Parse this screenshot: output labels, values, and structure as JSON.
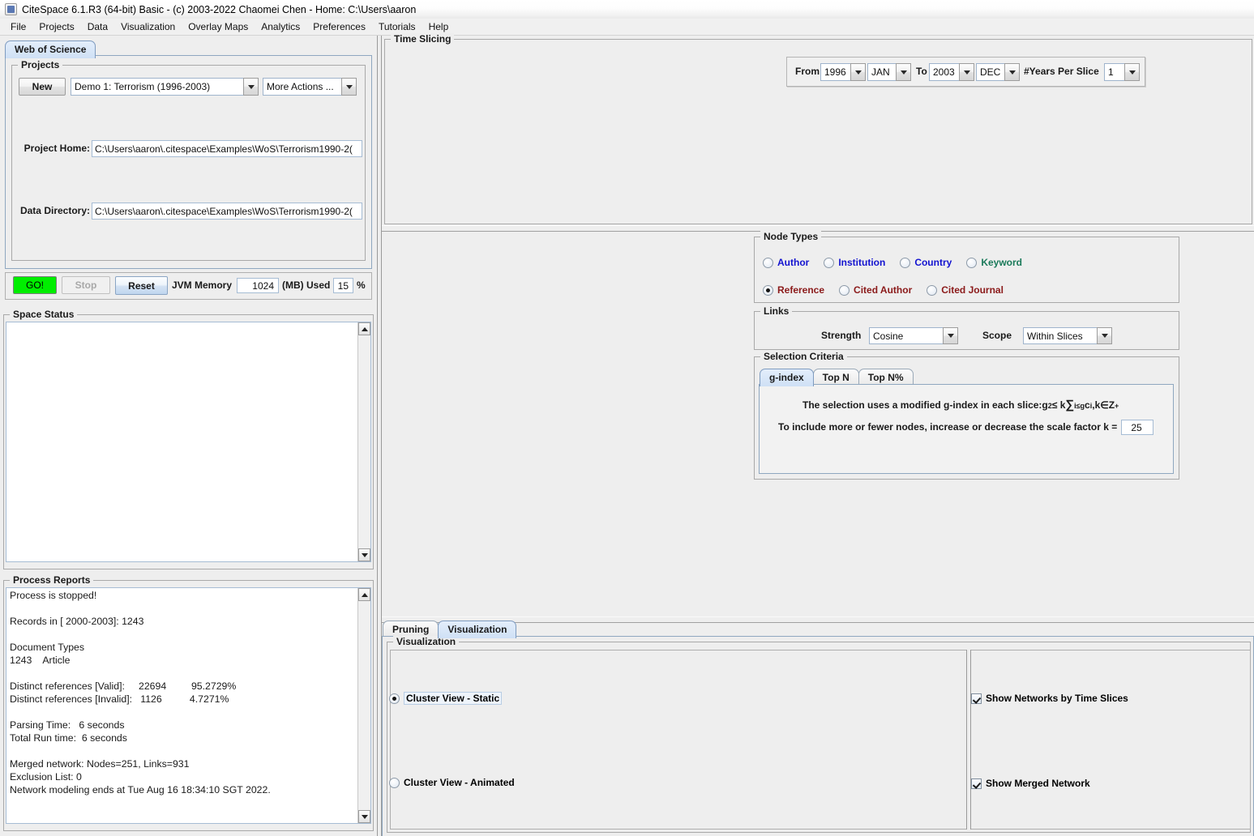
{
  "window": {
    "title": "CiteSpace 6.1.R3 (64-bit) Basic - (c) 2003-2022 Chaomei Chen - Home: C:\\Users\\aaron",
    "icon": "citespace-app-icon"
  },
  "menubar": {
    "items": [
      {
        "label": "File"
      },
      {
        "label": "Projects"
      },
      {
        "label": "Data"
      },
      {
        "label": "Visualization"
      },
      {
        "label": "Overlay Maps"
      },
      {
        "label": "Analytics"
      },
      {
        "label": "Preferences"
      },
      {
        "label": "Tutorials"
      },
      {
        "label": "Help"
      }
    ]
  },
  "left": {
    "tab": {
      "label": "Web of Science"
    },
    "projects": {
      "title": "Projects",
      "new_button": "New",
      "project_combo": "Demo 1: Terrorism (1996-2003)",
      "more_actions_combo": "More Actions ...",
      "project_home_label": "Project Home:",
      "project_home_value": "C:\\Users\\aaron\\.citespace\\Examples\\WoS\\Terrorism1990-2(",
      "data_directory_label": "Data Directory:",
      "data_directory_value": "C:\\Users\\aaron\\.citespace\\Examples\\WoS\\Terrorism1990-2("
    },
    "run_bar": {
      "go_button": "GO!",
      "stop_button": "Stop",
      "reset_button": "Reset",
      "jvm_memory_label": "JVM Memory",
      "jvm_memory_value": "1024",
      "mb_used_label": "(MB) Used",
      "used_percent_value": "15",
      "percent_symbol": "%"
    },
    "space_status": {
      "title": "Space Status",
      "content": ""
    },
    "process_reports": {
      "title": "Process Reports",
      "content": "Process is stopped!\n\nRecords in [ 2000-2003]: 1243\n\nDocument Types\n1243    Article\n\nDistinct references [Valid]:     22694         95.2729%\nDistinct references [Invalid]:   1126          4.7271%\n\nParsing Time:   6 seconds\nTotal Run time:  6 seconds\n\nMerged network: Nodes=251, Links=931\nExclusion List: 0\nNetwork modeling ends at Tue Aug 16 18:34:10 SGT 2022."
    }
  },
  "time_slicing": {
    "title": "Time Slicing",
    "from_label": "From",
    "from_year": "1996",
    "from_month": "JAN",
    "to_label": "To",
    "to_year": "2003",
    "to_month": "DEC",
    "years_per_slice_label": "#Years Per Slice",
    "years_per_slice": "1"
  },
  "node_types": {
    "title": "Node Types",
    "row1": [
      {
        "label": "Author",
        "selected": false,
        "color": "#1414d0"
      },
      {
        "label": "Institution",
        "selected": false,
        "color": "#1414d0"
      },
      {
        "label": "Country",
        "selected": false,
        "color": "#1414d0"
      },
      {
        "label": "Keyword",
        "selected": false,
        "color": "#1b7a5a"
      }
    ],
    "row2": [
      {
        "label": "Reference",
        "selected": true,
        "color": "#8b1a1a"
      },
      {
        "label": "Cited Author",
        "selected": false,
        "color": "#8b1a1a"
      },
      {
        "label": "Cited Journal",
        "selected": false,
        "color": "#8b1a1a"
      }
    ]
  },
  "links": {
    "title": "Links",
    "strength_label": "Strength",
    "strength_value": "Cosine",
    "scope_label": "Scope",
    "scope_value": "Within Slices"
  },
  "selection_criteria": {
    "title": "Selection Criteria",
    "tabs": [
      {
        "label": "g-index",
        "active": true
      },
      {
        "label": "Top N",
        "active": false
      },
      {
        "label": "Top N%",
        "active": false
      }
    ],
    "formula_prefix": "The selection uses a modified g-index in each slice: ",
    "formula": {
      "g": "g",
      "sup2": "2",
      "rel": " ≤ k",
      "sigma": "∑",
      "sigma_sub": "i≤g",
      "c": "c",
      "c_sub": "i",
      "comma": ",",
      "k_in": "k∈Z",
      "plus": "+"
    },
    "scale_label": "To include more or fewer nodes, increase or decrease the scale factor k =",
    "scale_value": "25"
  },
  "bottom": {
    "tabs": [
      {
        "label": "Pruning",
        "active": false
      },
      {
        "label": "Visualization",
        "active": true
      }
    ],
    "panel_title": "Visualization",
    "left_options": [
      {
        "label": "Cluster View - Static",
        "selected": true,
        "focused": true
      },
      {
        "label": "Cluster View - Animated",
        "selected": false,
        "focused": false
      }
    ],
    "right_options": [
      {
        "label": "Show Networks by Time Slices",
        "checked": true
      },
      {
        "label": "Show Merged Network",
        "checked": true
      }
    ]
  }
}
